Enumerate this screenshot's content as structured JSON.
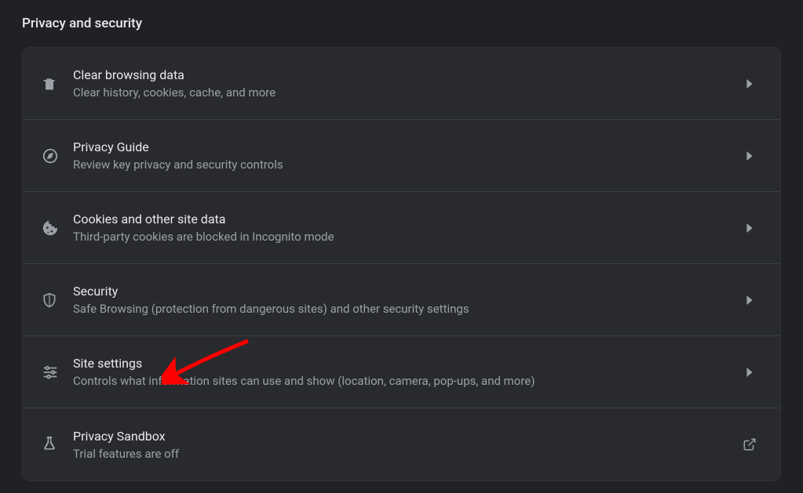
{
  "sectionTitle": "Privacy and security",
  "rows": [
    {
      "id": "clear-data",
      "icon": "trash-icon",
      "title": "Clear browsing data",
      "subtitle": "Clear history, cookies, cache, and more",
      "nav": "chevron"
    },
    {
      "id": "privacy-guide",
      "icon": "compass-icon",
      "title": "Privacy Guide",
      "subtitle": "Review key privacy and security controls",
      "nav": "chevron"
    },
    {
      "id": "cookies",
      "icon": "cookie-icon",
      "title": "Cookies and other site data",
      "subtitle": "Third-party cookies are blocked in Incognito mode",
      "nav": "chevron"
    },
    {
      "id": "security",
      "icon": "shield-icon",
      "title": "Security",
      "subtitle": "Safe Browsing (protection from dangerous sites) and other security settings",
      "nav": "chevron"
    },
    {
      "id": "site-settings",
      "icon": "sliders-icon",
      "title": "Site settings",
      "subtitle": "Controls what information sites can use and show (location, camera, pop-ups, and more)",
      "nav": "chevron"
    },
    {
      "id": "privacy-sandbox",
      "icon": "flask-icon",
      "title": "Privacy Sandbox",
      "subtitle": "Trial features are off",
      "nav": "external"
    }
  ]
}
